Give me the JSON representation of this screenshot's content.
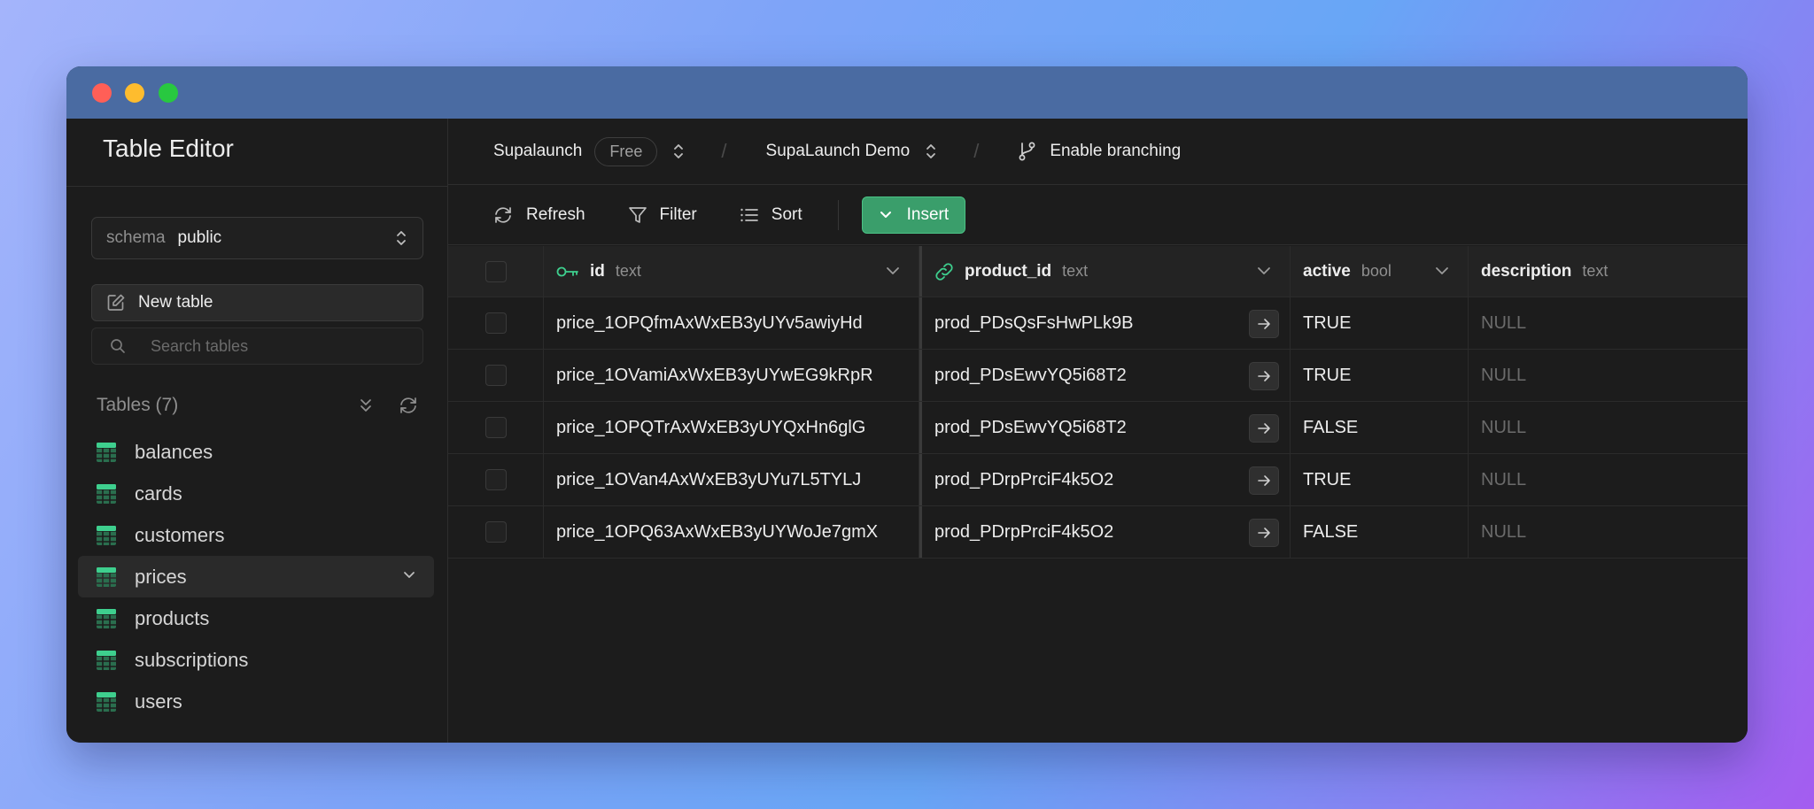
{
  "window": {
    "traffic_lights": [
      "close",
      "minimize",
      "zoom"
    ]
  },
  "sidebar": {
    "title": "Table Editor",
    "schema": {
      "label": "schema",
      "value": "public"
    },
    "new_table_label": "New table",
    "search_placeholder": "Search tables",
    "tables_heading": "Tables (7)",
    "tables": [
      {
        "name": "balances"
      },
      {
        "name": "cards"
      },
      {
        "name": "customers"
      },
      {
        "name": "prices",
        "active": true
      },
      {
        "name": "products"
      },
      {
        "name": "subscriptions"
      },
      {
        "name": "users"
      }
    ]
  },
  "topbar": {
    "org": "Supalaunch",
    "plan_badge": "Free",
    "project": "SupaLaunch Demo",
    "branching_label": "Enable branching"
  },
  "toolbar": {
    "refresh": "Refresh",
    "filter": "Filter",
    "sort": "Sort",
    "insert": "Insert"
  },
  "grid": {
    "columns": [
      {
        "name": "id",
        "type": "text",
        "icon": "key-icon"
      },
      {
        "name": "product_id",
        "type": "text",
        "icon": "link-icon"
      },
      {
        "name": "active",
        "type": "bool"
      },
      {
        "name": "description",
        "type": "text"
      }
    ],
    "rows": [
      {
        "id": "price_1OPQfmAxWxEB3yUYv5awiyHd",
        "product_id": "prod_PDsQsFsHwPLk9B",
        "active": "TRUE",
        "description": "NULL"
      },
      {
        "id": "price_1OVamiAxWxEB3yUYwEG9kRpR",
        "product_id": "prod_PDsEwvYQ5i68T2",
        "active": "TRUE",
        "description": "NULL"
      },
      {
        "id": "price_1OPQTrAxWxEB3yUYQxHn6glG",
        "product_id": "prod_PDsEwvYQ5i68T2",
        "active": "FALSE",
        "description": "NULL"
      },
      {
        "id": "price_1OVan4AxWxEB3yUYu7L5TYLJ",
        "product_id": "prod_PDrpPrciF4k5O2",
        "active": "TRUE",
        "description": "NULL"
      },
      {
        "id": "price_1OPQ63AxWxEB3yUYWoJe7gmX",
        "product_id": "prod_PDrpPrciF4k5O2",
        "active": "FALSE",
        "description": "NULL"
      }
    ]
  },
  "colors": {
    "accent": "#3ecf8e",
    "insert_button": "#3a9e6b",
    "titlebar": "#4a6ba2"
  }
}
